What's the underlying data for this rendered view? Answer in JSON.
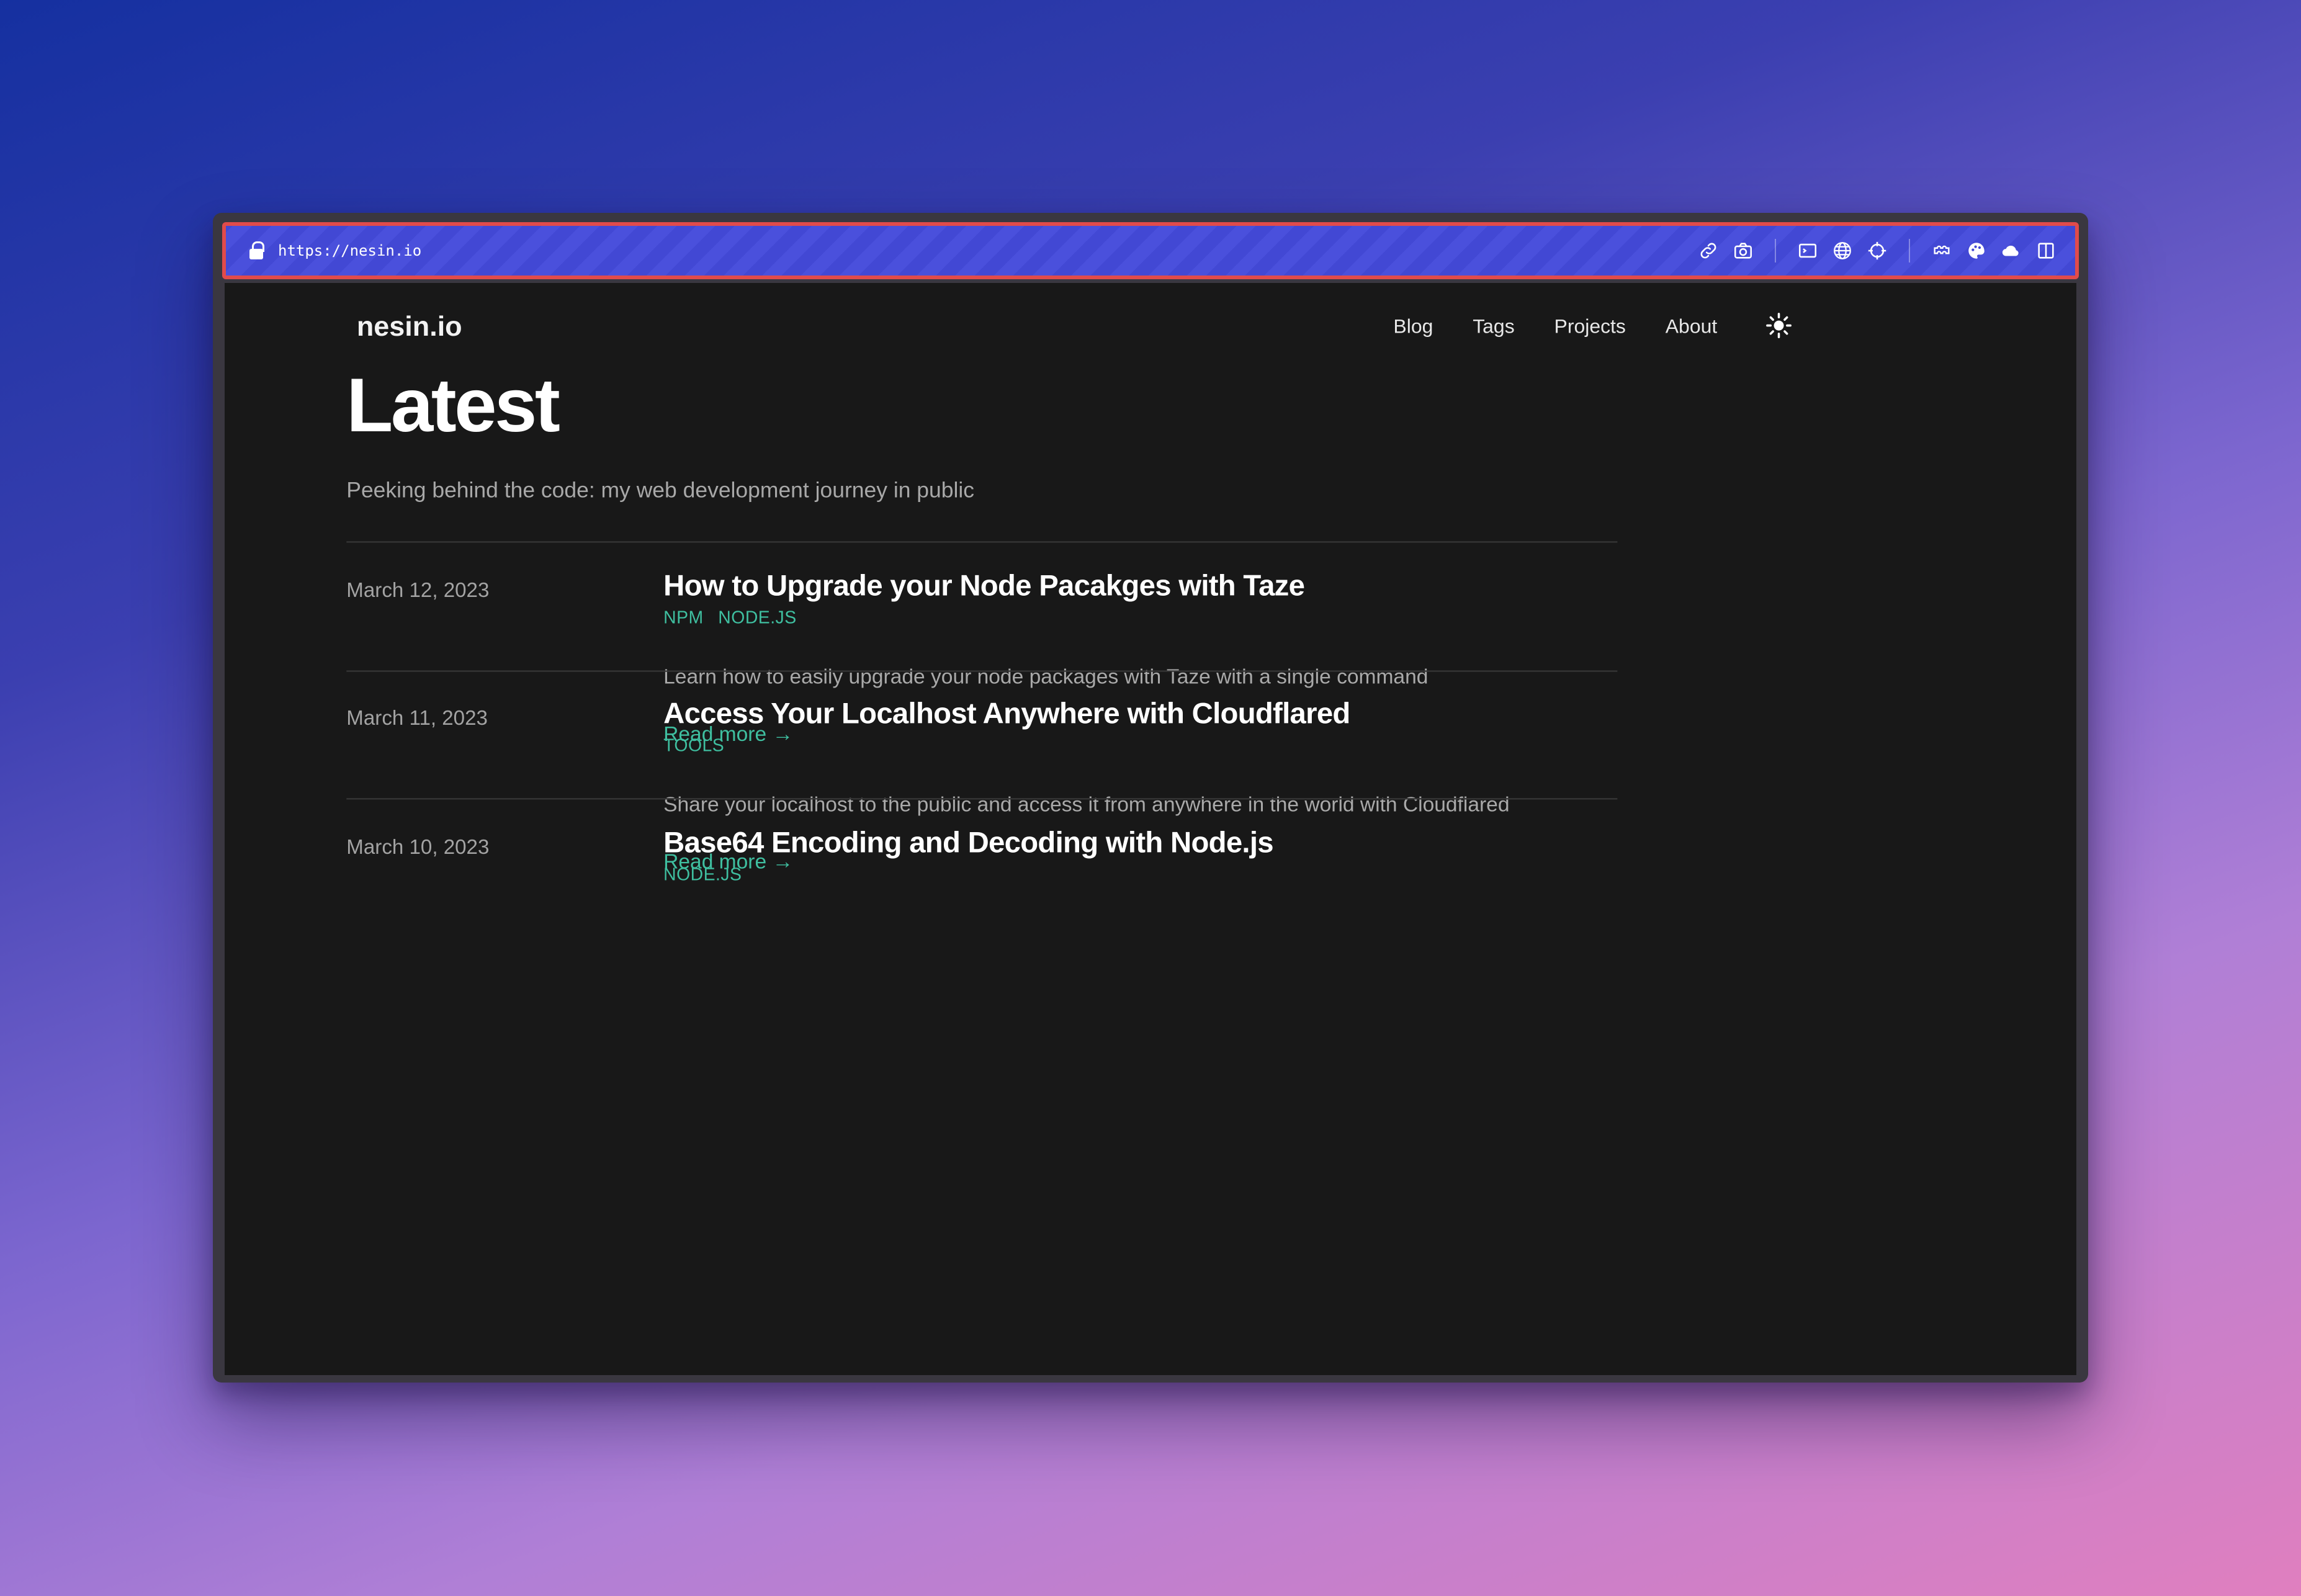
{
  "browser": {
    "url": "https://nesin.io",
    "icons": [
      "link-icon",
      "camera-icon",
      "terminal-icon",
      "globe-icon",
      "crosshair-icon",
      "extensions-icon",
      "palette-icon",
      "cloud-icon",
      "sidebar-icon"
    ],
    "toolbar_color": "#4248d4",
    "highlight_color": "#e14b4b"
  },
  "site": {
    "brand": "nesin.io",
    "nav": [
      "Blog",
      "Tags",
      "Projects",
      "About"
    ],
    "theme_toggle_icon": "sun-icon"
  },
  "page": {
    "title": "Latest",
    "subtitle": "Peeking behind the code: my web development journey in public"
  },
  "posts": [
    {
      "date": "March 12, 2023",
      "title": "How to Upgrade your Node Pacakges with Taze",
      "tags": [
        "NPM",
        "NODE.JS"
      ],
      "summary": "Learn how to easily upgrade your node packages with Taze with a single command",
      "read_more": "Read more →"
    },
    {
      "date": "March 11, 2023",
      "title": "Access Your Localhost Anywhere with Cloudflared",
      "tags": [
        "TOOLS"
      ],
      "summary": "Share your localhost to the public and access it from anywhere in the world with Cloudflared",
      "read_more": "Read more →"
    },
    {
      "date": "March 10, 2023",
      "title": "Base64 Encoding and Decoding with Node.js",
      "tags": [
        "NODE.JS"
      ]
    }
  ],
  "colors": {
    "accent": "#3fbfa0",
    "background": "#181818"
  }
}
